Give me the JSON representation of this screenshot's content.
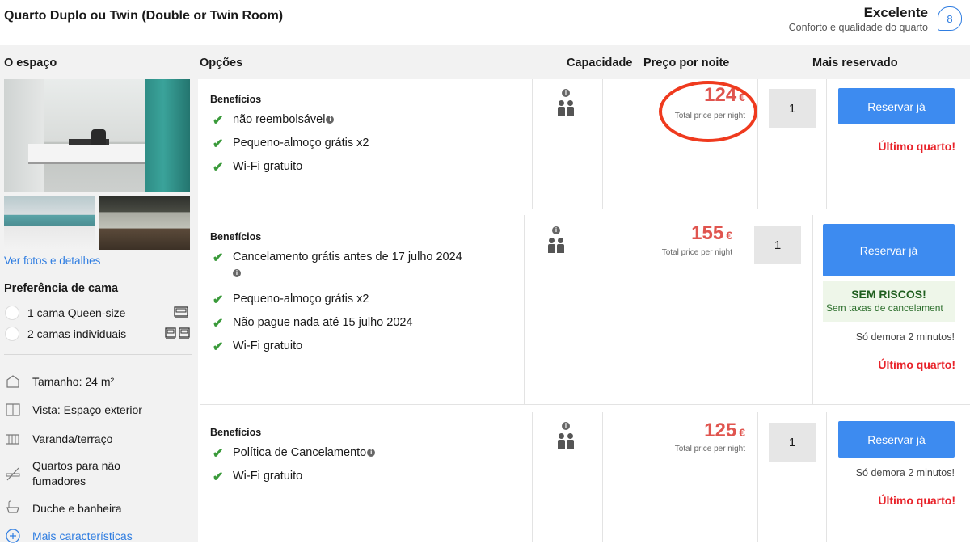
{
  "room": {
    "title": "Quarto Duplo ou Twin (Double or Twin Room)",
    "rating_label": "Excelente",
    "rating_sub": "Conforto e qualidade do quarto",
    "rating_score": "8"
  },
  "headers": {
    "space": "O espaço",
    "options": "Opções",
    "capacity": "Capacidade",
    "price": "Preço por noite",
    "most_booked": "Mais reservado"
  },
  "left": {
    "photos_link": "Ver fotos e detalhes",
    "bed_pref_title": "Preferência de cama",
    "beds": [
      {
        "label": "1 cama Queen-size"
      },
      {
        "label": "2 camas individuais"
      }
    ],
    "features": [
      {
        "icon": "size-icon",
        "label": "Tamanho: 24 m²"
      },
      {
        "icon": "view-icon",
        "label": "Vista: Espaço exterior"
      },
      {
        "icon": "balcony-icon",
        "label": "Varanda/terraço"
      },
      {
        "icon": "no-smoking-icon",
        "label": "Quartos para não fumadores"
      },
      {
        "icon": "shower-icon",
        "label": "Duche e banheira"
      }
    ],
    "more_features": "Mais características"
  },
  "options": [
    {
      "benefits_title": "Benefícios",
      "benefits": [
        "não reembolsável",
        "Pequeno-almoço grátis x2",
        "Wi-Fi gratuito"
      ],
      "price": "124",
      "currency": "€",
      "price_sub": "Total price per night",
      "qty": "1",
      "button": "Reservar já",
      "last_room": "Último quarto!"
    },
    {
      "benefits_title": "Benefícios",
      "benefits": [
        "Cancelamento grátis antes de 17 julho 2024",
        "Pequeno-almoço grátis x2",
        "Não pague nada até 15 julho 2024",
        "Wi-Fi gratuito"
      ],
      "price": "155",
      "currency": "€",
      "price_sub": "Total price per night",
      "qty": "1",
      "button": "Reservar já",
      "no_risk_title": "SEM RISCOS!",
      "no_risk_sub": "Sem taxas de cancelament",
      "quick": "Só demora 2 minutos!",
      "last_room": "Último quarto!"
    },
    {
      "benefits_title": "Benefícios",
      "benefits": [
        "Política de Cancelamento",
        "Wi-Fi gratuito"
      ],
      "price": "125",
      "currency": "€",
      "price_sub": "Total price per night",
      "qty": "1",
      "button": "Reservar já",
      "quick": "Só demora 2 minutos!",
      "last_room": "Último quarto!"
    }
  ],
  "info_glyph": "i",
  "check_glyph": "✔"
}
